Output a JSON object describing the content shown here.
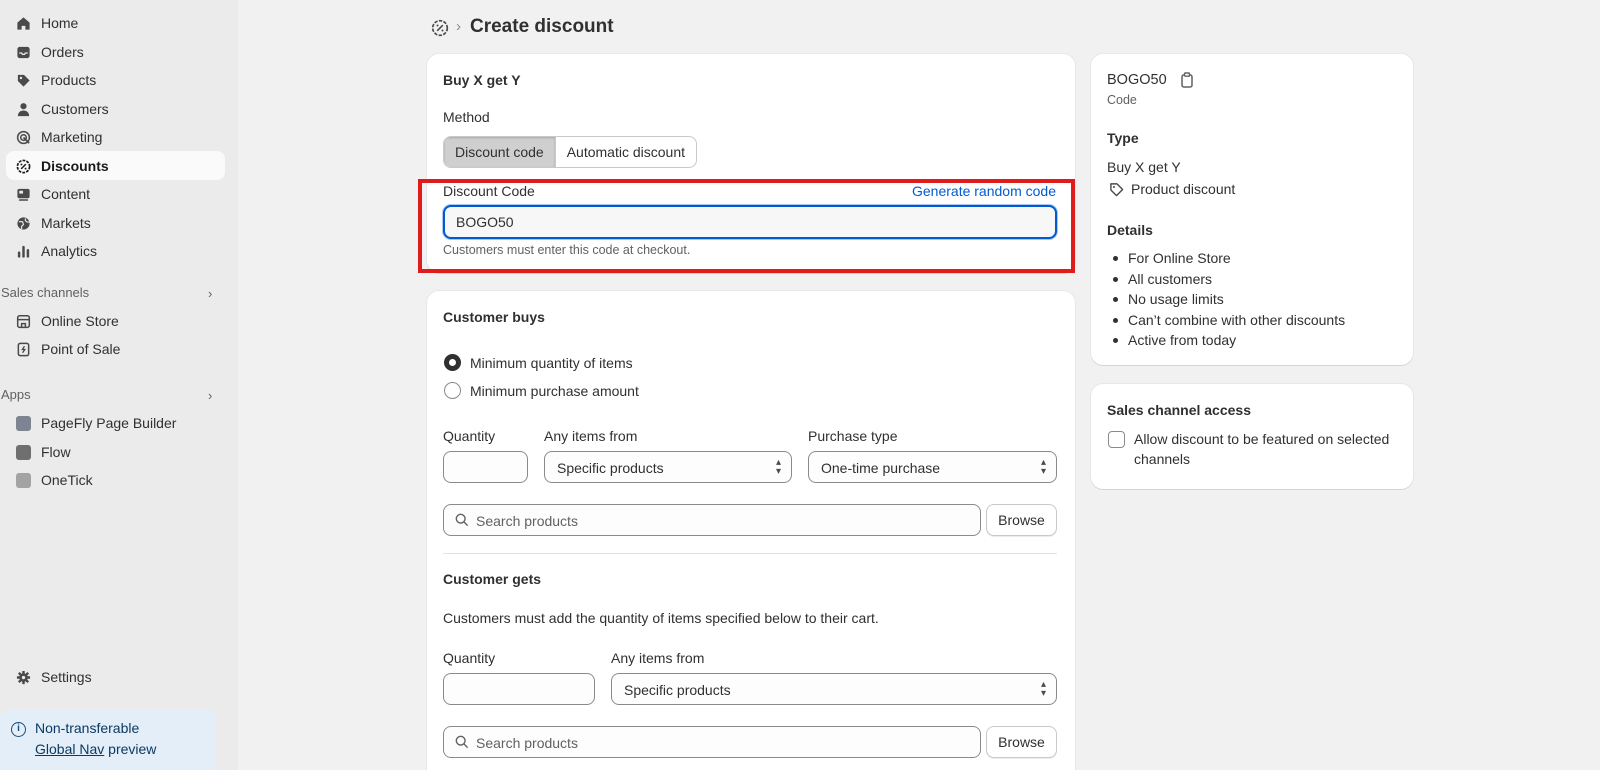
{
  "sidebar": {
    "items": [
      {
        "label": "Home",
        "icon": "home-icon"
      },
      {
        "label": "Orders",
        "icon": "inbox-icon"
      },
      {
        "label": "Products",
        "icon": "tag-icon"
      },
      {
        "label": "Customers",
        "icon": "person-icon"
      },
      {
        "label": "Marketing",
        "icon": "target-icon"
      },
      {
        "label": "Discounts",
        "icon": "discount-icon",
        "active": true
      },
      {
        "label": "Content",
        "icon": "content-icon"
      },
      {
        "label": "Markets",
        "icon": "globe-icon"
      },
      {
        "label": "Analytics",
        "icon": "bar-chart-icon"
      }
    ],
    "sales_channels_label": "Sales channels",
    "sales_channels": [
      {
        "label": "Online Store",
        "icon": "store-icon"
      },
      {
        "label": "Point of Sale",
        "icon": "pos-icon"
      }
    ],
    "apps_label": "Apps",
    "apps": [
      {
        "label": "PageFly Page Builder",
        "icon": "pagefly-icon"
      },
      {
        "label": "Flow",
        "icon": "flow-icon"
      },
      {
        "label": "OneTick",
        "icon": "onetick-icon"
      }
    ],
    "settings_label": "Settings",
    "notice": {
      "line1": "Non-transferable",
      "link": "Global Nav",
      "line2_rest": " preview"
    }
  },
  "header": {
    "title": "Create discount",
    "separator": "›"
  },
  "method_card": {
    "heading": "Buy X get Y",
    "method_label": "Method",
    "method_options": [
      "Discount code",
      "Automatic discount"
    ],
    "selected_method": "Discount code",
    "code_label": "Discount Code",
    "generate_link": "Generate random code",
    "code_value": "BOGO50",
    "code_help": "Customers must enter this code at checkout."
  },
  "buys_card": {
    "heading": "Customer buys",
    "radio_options": [
      "Minimum quantity of items",
      "Minimum purchase amount"
    ],
    "selected_radio": "Minimum quantity of items",
    "quantity_label": "Quantity",
    "quantity_value": "",
    "items_from_label": "Any items from",
    "items_from_value": "Specific products",
    "purchase_type_label": "Purchase type",
    "purchase_type_value": "One-time purchase",
    "search_placeholder": "Search products",
    "browse_label": "Browse",
    "gets_heading": "Customer gets",
    "gets_help": "Customers must add the quantity of items specified below to their cart.",
    "gets_quantity_label": "Quantity",
    "gets_quantity_value": "",
    "gets_items_from_label": "Any items from",
    "gets_items_from_value": "Specific products",
    "gets_search_placeholder": "Search products",
    "gets_browse_label": "Browse"
  },
  "summary_card": {
    "code": "BOGO50",
    "code_caption": "Code",
    "type_heading": "Type",
    "type_value": "Buy X get Y",
    "type_sub": "Product discount",
    "details_heading": "Details",
    "details": [
      "For Online Store",
      "All customers",
      "No usage limits",
      "Can’t combine with other discounts",
      "Active from today"
    ]
  },
  "channel_card": {
    "heading": "Sales channel access",
    "checkbox_line1": "Allow discount to be featured on selected",
    "checkbox_line2": "channels",
    "checked": false
  },
  "colors": {
    "accent": "#005bd3",
    "highlight": "#e01b1b",
    "sidebar_bg": "#ebebeb",
    "page_bg": "#f1f1f1"
  }
}
